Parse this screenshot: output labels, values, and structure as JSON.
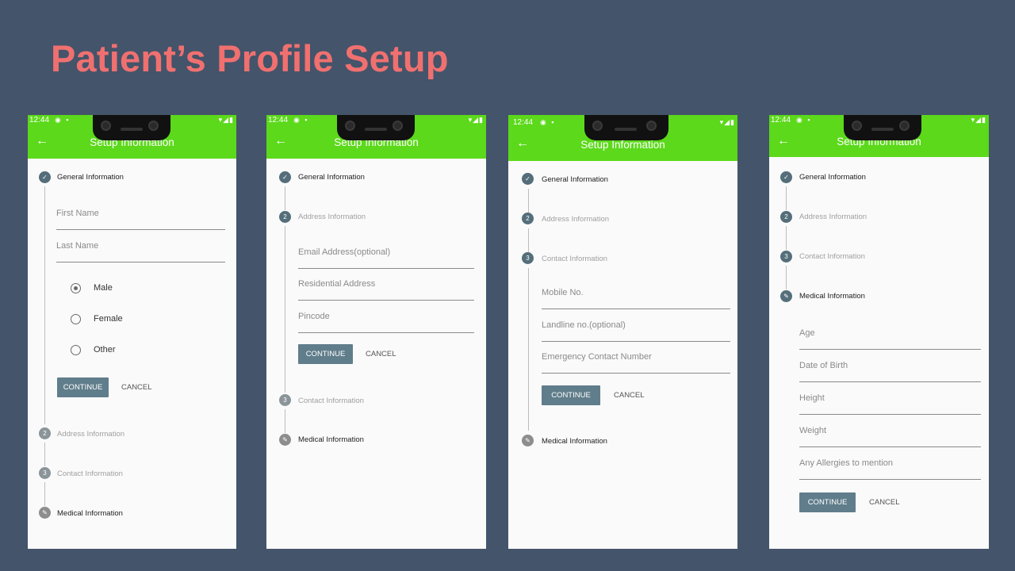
{
  "slide": {
    "title": "Patient’s Profile Setup"
  },
  "status": {
    "time": "12:44"
  },
  "app": {
    "title": "Setup Information",
    "back_icon": "arrow-left-icon"
  },
  "steps": {
    "general": "General Information",
    "address": "Address Information",
    "contact": "Contact Information",
    "medical": "Medical Information",
    "num2": "2",
    "num3": "3"
  },
  "buttons": {
    "continue": "CONTINUE",
    "cancel": "CANCEL"
  },
  "general_form": {
    "first_name_placeholder": "First Name",
    "last_name_placeholder": "Last Name",
    "gender_options": [
      "Male",
      "Female",
      "Other"
    ],
    "gender_selected": "Male"
  },
  "address_form": {
    "email_placeholder": "Email Address(optional)",
    "residential_placeholder": "Residential Address",
    "pincode_placeholder": "Pincode"
  },
  "contact_form": {
    "mobile_placeholder": "Mobile No.",
    "landline_placeholder": "Landline no.(optional)",
    "emergency_placeholder": "Emergency Contact Number"
  },
  "medical_form": {
    "age_placeholder": "Age",
    "dob_placeholder": "Date of Birth",
    "height_placeholder": "Height",
    "weight_placeholder": "Weight",
    "allergies_placeholder": "Any Allergies to mention"
  },
  "colors": {
    "background": "#44546a",
    "title": "#f07070",
    "appbar": "#5bd91a",
    "button": "#607d8b",
    "step": "#546e7a"
  }
}
